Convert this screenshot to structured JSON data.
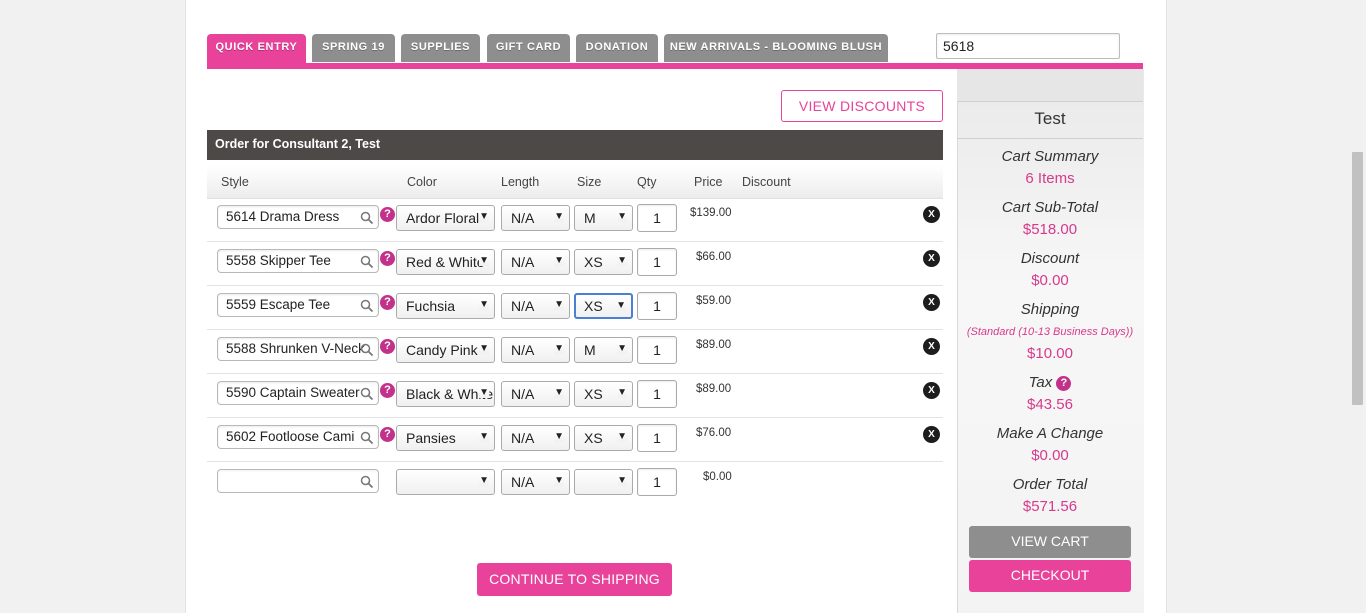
{
  "tabs": [
    {
      "label": "QUICK ENTRY",
      "active": true
    },
    {
      "label": "SPRING 19",
      "active": false
    },
    {
      "label": "SUPPLIES",
      "active": false
    },
    {
      "label": "GIFT CARD",
      "active": false
    },
    {
      "label": "DONATION",
      "active": false
    },
    {
      "label": "NEW ARRIVALS - BLOOMING BLUSH",
      "active": false
    }
  ],
  "style_search": {
    "value": "5618"
  },
  "view_discounts_label": "VIEW DISCOUNTS",
  "order_title": "Order for Consultant 2, Test",
  "columns": [
    "Style",
    "Color",
    "Length",
    "Size",
    "Qty",
    "Price",
    "Discount"
  ],
  "rows": [
    {
      "style": "5614 Drama Dress",
      "color": "Ardor Floral",
      "length": "N/A",
      "size": "M",
      "qty": "1",
      "price": "$139.00"
    },
    {
      "style": "5558 Skipper Tee",
      "color": "Red & White",
      "length": "N/A",
      "size": "XS",
      "qty": "1",
      "price": "$66.00"
    },
    {
      "style": "5559 Escape Tee",
      "color": "Fuchsia",
      "length": "N/A",
      "size": "XS",
      "qty": "1",
      "price": "$59.00"
    },
    {
      "style": "5588 Shrunken V-Neck",
      "color": "Candy Pink",
      "length": "N/A",
      "size": "M",
      "qty": "1",
      "price": "$89.00"
    },
    {
      "style": "5590 Captain Sweater",
      "color": "Black & White",
      "length": "N/A",
      "size": "XS",
      "qty": "1",
      "price": "$89.00"
    },
    {
      "style": "5602 Footloose Cami",
      "color": "Pansies",
      "length": "N/A",
      "size": "XS",
      "qty": "1",
      "price": "$76.00"
    }
  ],
  "empty_row": {
    "style": "",
    "color": "",
    "length": "N/A",
    "size": "",
    "qty": "1",
    "price": "$0.00"
  },
  "help_symbol": "?",
  "remove_symbol": "X",
  "continue_label": "CONTINUE TO SHIPPING",
  "sidebar": {
    "name": "Test",
    "cart_summary_label": "Cart Summary",
    "cart_summary_value": "6 Items",
    "subtotal_label": "Cart Sub-Total",
    "subtotal_value": "$518.00",
    "discount_label": "Discount",
    "discount_value": "$0.00",
    "shipping_label": "Shipping",
    "shipping_method": "(Standard (10-13 Business Days))",
    "shipping_value": "$10.00",
    "tax_label": "Tax",
    "tax_value": "$43.56",
    "change_label": "Make A Change",
    "change_value": "$0.00",
    "total_label": "Order Total",
    "total_value": "$571.56",
    "view_cart_label": "VIEW CART",
    "checkout_label": "CHECKOUT"
  },
  "colors": {
    "accent": "#e8429a",
    "tab_inactive": "#8e8e8e",
    "header_dark": "#4d4947",
    "value_pink": "#d63a8d"
  }
}
